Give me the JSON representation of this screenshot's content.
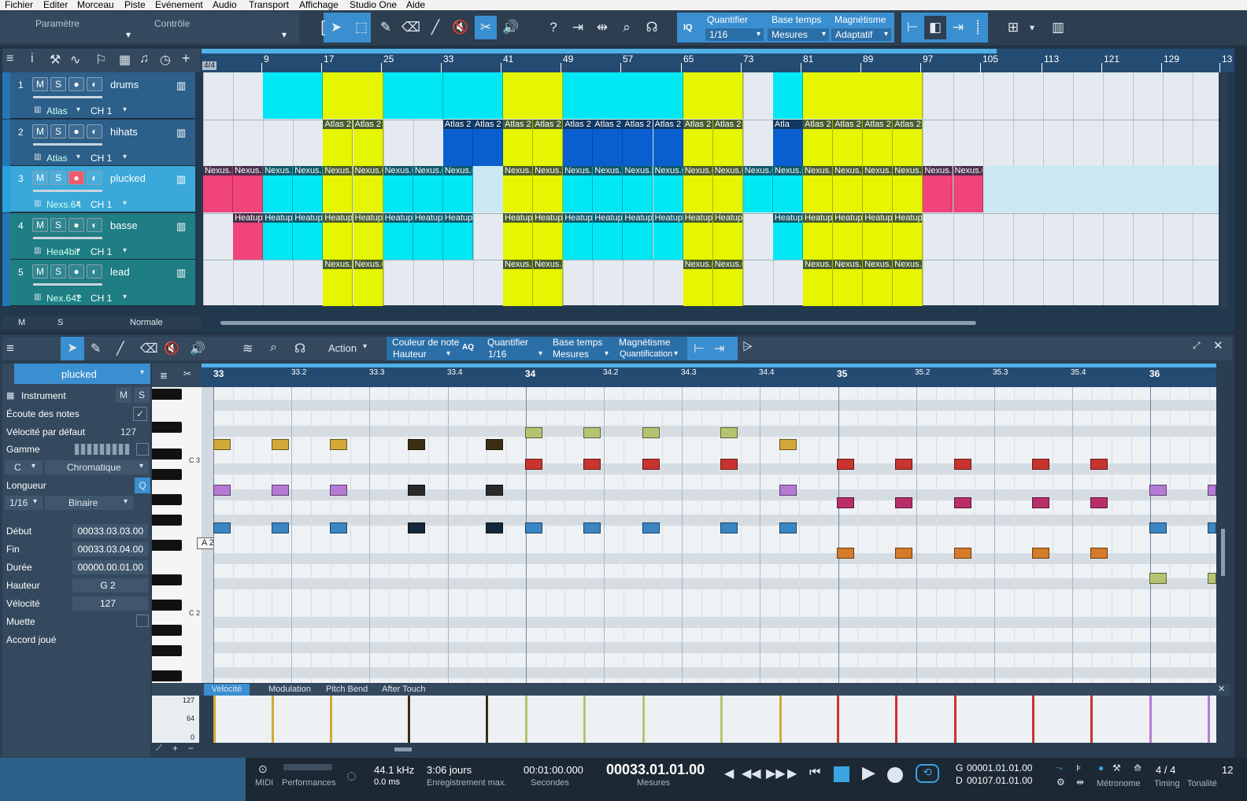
{
  "menu": [
    "Fichier",
    "Editer",
    "Morceau",
    "Piste",
    "Evénement",
    "Audio",
    "Transport",
    "Affichage",
    "Studio One",
    "Aide"
  ],
  "toolbar": {
    "tab_param": "Paramètre",
    "tab_control": "Contrôle",
    "iq": "IQ",
    "quantifier_label": "Quantifier",
    "quantifier_value": "1/16",
    "base_label": "Base temps",
    "base_value": "Mesures",
    "magnet_label": "Magnétisme",
    "magnet_value": "Adaptatif"
  },
  "arrange": {
    "signature": "4/4",
    "ruler": [
      "9",
      "17",
      "25",
      "33",
      "41",
      "49",
      "57",
      "65",
      "73",
      "81",
      "89",
      "97",
      "105",
      "113",
      "121",
      "129",
      "13"
    ],
    "tracks": [
      {
        "num": "1",
        "name": "drums",
        "instrument": "Atlas",
        "channel": "CH 1"
      },
      {
        "num": "2",
        "name": "hihats",
        "instrument": "Atlas",
        "channel": "CH 1"
      },
      {
        "num": "3",
        "name": "plucked",
        "instrument": "Nexs.64",
        "channel": "CH 1"
      },
      {
        "num": "4",
        "name": "basse",
        "instrument": "Hea4bit",
        "channel": "CH 1"
      },
      {
        "num": "5",
        "name": "lead",
        "instrument": "Nex.642",
        "channel": "CH 1"
      }
    ],
    "m_label": "M",
    "s_label": "S",
    "mode": "Normale",
    "clip_atlas": "Atlas 2",
    "clip_atl": "Atla",
    "clip_nexus": "Nexus.6",
    "clip_heatup": "Heatup"
  },
  "editor": {
    "action": "Action",
    "color_label": "Couleur de note",
    "color_value": "Hauteur",
    "aq": "AQ",
    "quantifier_label": "Quantifier",
    "quantifier_value": "1/16",
    "base_label": "Base temps",
    "base_value": "Mesures",
    "magnet_label": "Magnétisme",
    "magnet_value": "Quantification",
    "ruler": [
      "33",
      "33.2",
      "33.3",
      "33.4",
      "34",
      "34.2",
      "34.3",
      "34.4",
      "35",
      "35.2",
      "35.3",
      "35.4",
      "36"
    ],
    "c3": "C 3",
    "c2": "C 2",
    "hover_note": "A 2",
    "tabs": [
      "Velocité",
      "Modulation",
      "Pitch Bend",
      "After Touch"
    ],
    "vel_scale": [
      "127",
      "64",
      "0"
    ]
  },
  "inspector": {
    "track": "plucked",
    "instrument": "Instrument",
    "m": "M",
    "s": "S",
    "ecoute": "Écoute des notes",
    "vel_def_label": "Vélocité par défaut",
    "vel_def": "127",
    "gamme": "Gamme",
    "key": "C",
    "scale": "Chromatique",
    "longueur": "Longueur",
    "q": "Q",
    "len_value": "1/16",
    "len_mode": "Binaire",
    "debut_label": "Début",
    "debut": "00033.03.03.00",
    "fin_label": "Fin",
    "fin": "00033.03.04.00",
    "duree_label": "Durée",
    "duree": "00000.00.01.00",
    "hauteur_label": "Hauteur",
    "hauteur": "G 2",
    "velocite_label": "Vélocité",
    "velocite": "127",
    "muette": "Muette",
    "accord": "Accord joué"
  },
  "transport": {
    "midi": "MIDI",
    "perf": "Performances",
    "rate": "44.1 kHz",
    "latency": "0.0 ms",
    "rec": "3:06 jours",
    "rec_sub": "Enregistrement max.",
    "seconds": "00:01:00.000",
    "seconds_sub": "Secondes",
    "bars": "00033.01.01.00",
    "bars_sub": "Mesures",
    "g_label": "G",
    "g_value": "00001.01.01.00",
    "d_label": "D",
    "d_value": "00107.01.01.00",
    "metro": "Métronome",
    "timing_value": "4 / 4",
    "timing": "Timing",
    "tonalite": "Tonalité",
    "tempo": "12"
  },
  "colors": {
    "cyan": "#00e8f4",
    "yellow": "#e6f500",
    "blue": "#0a5fd0",
    "pink": "#f0447a",
    "teal": "#1e8f98",
    "accent": "#3a8fd0"
  }
}
